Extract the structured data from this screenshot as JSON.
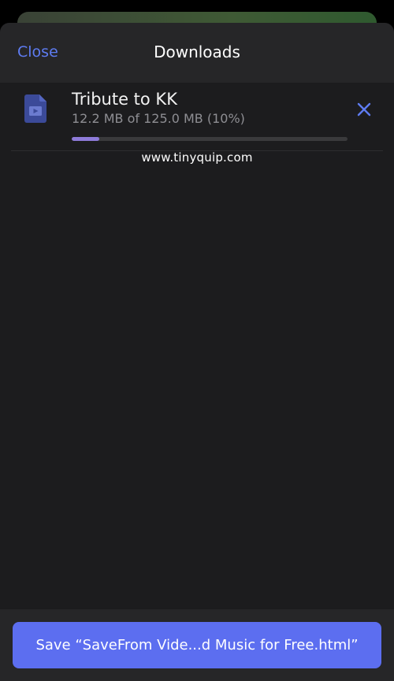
{
  "nav": {
    "close_label": "Close",
    "title": "Downloads"
  },
  "download": {
    "file_name": "Tribute to KK",
    "progress_text": "12.2 MB of 125.0 MB (10%)",
    "progress_fraction": 0.1,
    "file_icon": "video-file-icon",
    "cancel_icon": "close-icon"
  },
  "watermark": "www.tinyquip.com",
  "save_button_label": "Save “SaveFrom Vide...d Music for Free.html”",
  "colors": {
    "accent": "#5e7cf2",
    "button": "#5c6ef0",
    "progress": "#8e7bd9",
    "file_icon": "#3b4a99"
  }
}
